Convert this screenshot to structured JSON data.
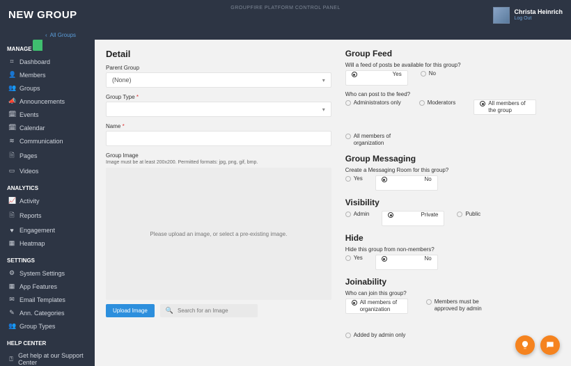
{
  "topbar": {
    "title": "NEW GROUP",
    "center": "GROUPFIRE PLATFORM CONTROL PANEL",
    "user_name": "Christa Heinrich",
    "logout": "Log Out"
  },
  "subbar": {
    "back": "All Groups"
  },
  "sidebar": {
    "sections": [
      {
        "head": "MANAGE",
        "items": [
          {
            "icon": "⌗",
            "label": "Dashboard"
          },
          {
            "icon": "👤",
            "label": "Members"
          },
          {
            "icon": "👥",
            "label": "Groups"
          },
          {
            "icon": "📣",
            "label": "Announcements"
          },
          {
            "icon": "🗓",
            "label": "Events"
          },
          {
            "icon": "🗓",
            "label": "Calendar"
          },
          {
            "icon": "≋",
            "label": "Communication"
          },
          {
            "icon": "🗎",
            "label": "Pages"
          },
          {
            "icon": "▭",
            "label": "Videos"
          }
        ]
      },
      {
        "head": "ANALYTICS",
        "items": [
          {
            "icon": "📈",
            "label": "Activity"
          },
          {
            "icon": "🗎",
            "label": "Reports"
          },
          {
            "icon": "♥",
            "label": "Engagement"
          },
          {
            "icon": "▦",
            "label": "Heatmap"
          }
        ]
      },
      {
        "head": "SETTINGS",
        "items": [
          {
            "icon": "⚙",
            "label": "System Settings"
          },
          {
            "icon": "▦",
            "label": "App Features"
          },
          {
            "icon": "✉",
            "label": "Email Templates"
          },
          {
            "icon": "✎",
            "label": "Ann. Categories"
          },
          {
            "icon": "👥",
            "label": "Group Types"
          }
        ]
      },
      {
        "head": "HELP CENTER",
        "items": [
          {
            "icon": "⍰",
            "label": "Get help at our Support Center"
          }
        ]
      }
    ]
  },
  "detail": {
    "heading": "Detail",
    "parent_label": "Parent Group",
    "parent_value": "(None)",
    "type_label": "Group Type",
    "name_label": "Name",
    "name_value": "",
    "image_label": "Group Image",
    "image_hint": "Image must be at least 200x200. Permitted formats: jpg, png, gif, bmp.",
    "image_drop": "Please upload an image, or select a pre-existing image.",
    "upload_btn": "Upload Image",
    "search_placeholder": "Search for an Image"
  },
  "feed": {
    "heading": "Group Feed",
    "q1": "Will a feed of posts be available for this group?",
    "yes": "Yes",
    "no": "No",
    "q2": "Who can post to the feed?",
    "opts2": [
      "Administrators only",
      "Moderators",
      "All members of the group",
      "All members of organization"
    ],
    "selected2": 2
  },
  "messaging": {
    "heading": "Group Messaging",
    "q": "Create a Messaging Room for this group?",
    "yes": "Yes",
    "no": "No"
  },
  "visibility": {
    "heading": "Visibility",
    "opts": [
      "Admin",
      "Private",
      "Public"
    ],
    "selected": 1
  },
  "hide": {
    "heading": "Hide",
    "q": "Hide this group from non-members?",
    "yes": "Yes",
    "no": "No"
  },
  "joinability": {
    "heading": "Joinability",
    "q": "Who can join this group?",
    "opts": [
      "All members of organization",
      "Members must be approved by admin",
      "Added by admin only"
    ],
    "selected": 0
  }
}
